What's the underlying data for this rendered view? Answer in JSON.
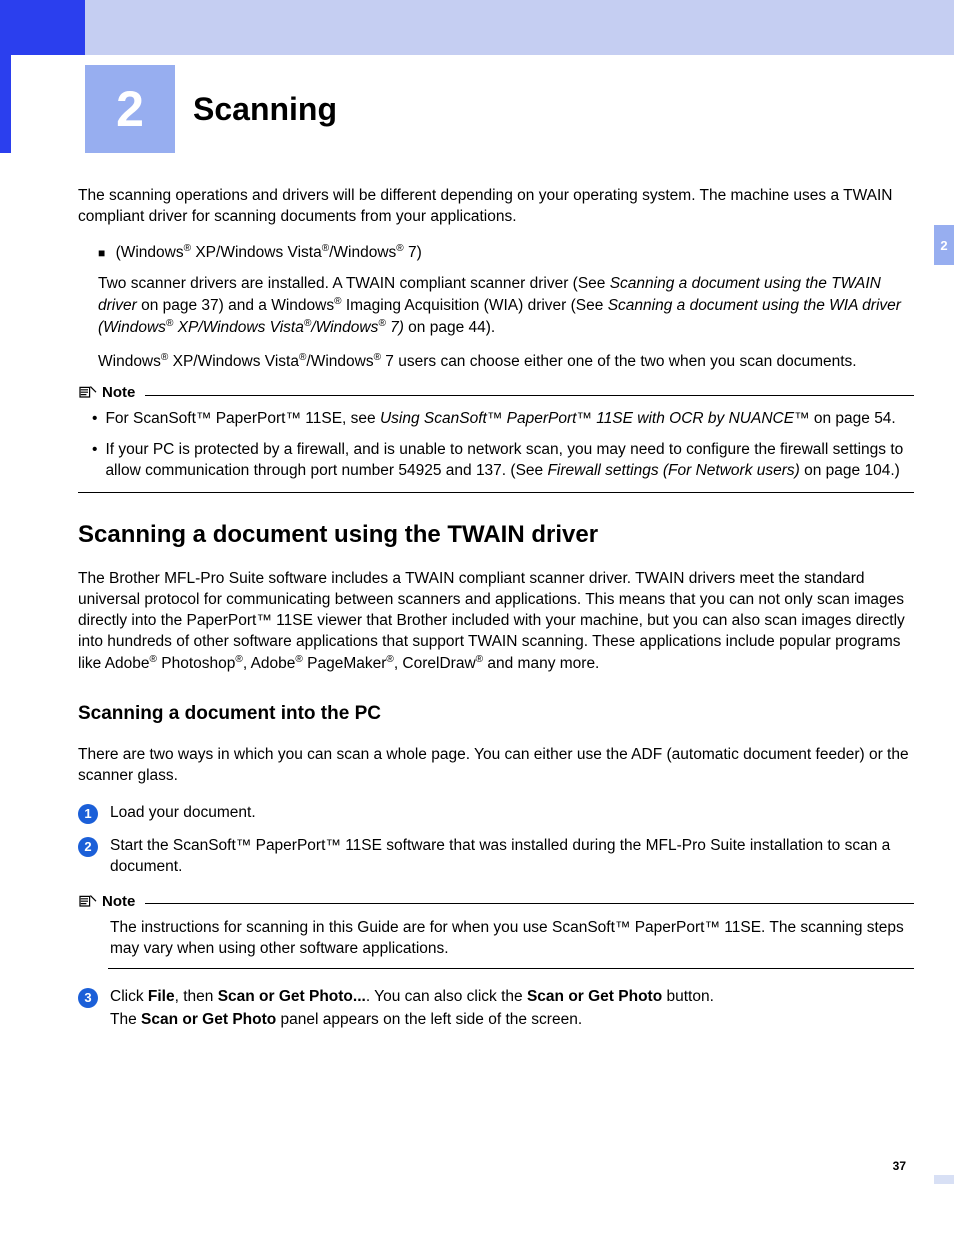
{
  "chapter": {
    "number": "2",
    "title": "Scanning"
  },
  "tab": "2",
  "intro": "The scanning operations and drivers will be different depending on your operating system. The machine uses a TWAIN compliant driver for scanning documents from your applications.",
  "bullet": {
    "head_pre": "(Windows",
    "head_mid1": " XP/Windows Vista",
    "head_mid2": "/Windows",
    "head_post": " 7)",
    "p1_a": "Two scanner drivers are installed. A TWAIN compliant scanner driver (See ",
    "p1_i1": "Scanning a document using the TWAIN driver",
    "p1_b": " on page 37) and a Windows",
    "p1_c": " Imaging Acquisition (WIA) driver (See ",
    "p1_i2": "Scanning a document using the WIA driver (Windows",
    "p1_i2b": " XP/Windows Vista",
    "p1_i2c": "/Windows",
    "p1_i2d": " 7)",
    "p1_d": " on page 44).",
    "p2_a": "Windows",
    "p2_b": " XP/Windows Vista",
    "p2_c": "/Windows",
    "p2_d": " 7 users can choose either one of the two when you scan documents."
  },
  "note1": {
    "label": "Note",
    "item1_a": "For ScanSoft™ PaperPort™ 11SE, see ",
    "item1_i": "Using ScanSoft™ PaperPort™ 11SE with OCR by NUANCE™",
    "item1_b": " on page 54.",
    "item2_a": "If your PC is protected by a firewall, and is unable to network scan, you may need to configure the firewall settings to allow communication through port number 54925 and 137. (See ",
    "item2_i": "Firewall settings (For Network users)",
    "item2_b": " on page 104.)"
  },
  "section1": {
    "title": "Scanning a document using the TWAIN driver",
    "p_a": "The Brother MFL-Pro Suite software includes a TWAIN compliant scanner driver. TWAIN drivers meet the standard universal protocol for communicating between scanners and applications. This means that you can not only scan images directly into the PaperPort™ 11SE viewer that Brother included with your machine, but you can also scan images directly into hundreds of other software applications that support TWAIN scanning. These applications include popular programs like Adobe",
    "p_b": " Photoshop",
    "p_c": ", Adobe",
    "p_d": " PageMaker",
    "p_e": ", CorelDraw",
    "p_f": " and many more."
  },
  "section2": {
    "title": "Scanning a document into the PC",
    "intro": "There are two ways in which you can scan a whole page. You can either use the ADF (automatic document feeder) or the scanner glass.",
    "step1": "Load your document.",
    "step2": "Start the ScanSoft™ PaperPort™ 11SE software that was installed during the MFL-Pro Suite installation to scan a document.",
    "note_label": "Note",
    "note": "The instructions for scanning in this Guide are for when you use ScanSoft™ PaperPort™ 11SE. The scanning steps may vary when using other software applications.",
    "step3_a": "Click ",
    "step3_b1": "File",
    "step3_c": ", then ",
    "step3_b2": "Scan or Get Photo...",
    "step3_d": ". You can also click the ",
    "step3_b3": "Scan or Get Photo",
    "step3_e": " button.",
    "step3_l2a": "The ",
    "step3_l2b": "Scan or Get Photo",
    "step3_l2c": " panel appears on the left side of the screen."
  },
  "page_number": "37"
}
